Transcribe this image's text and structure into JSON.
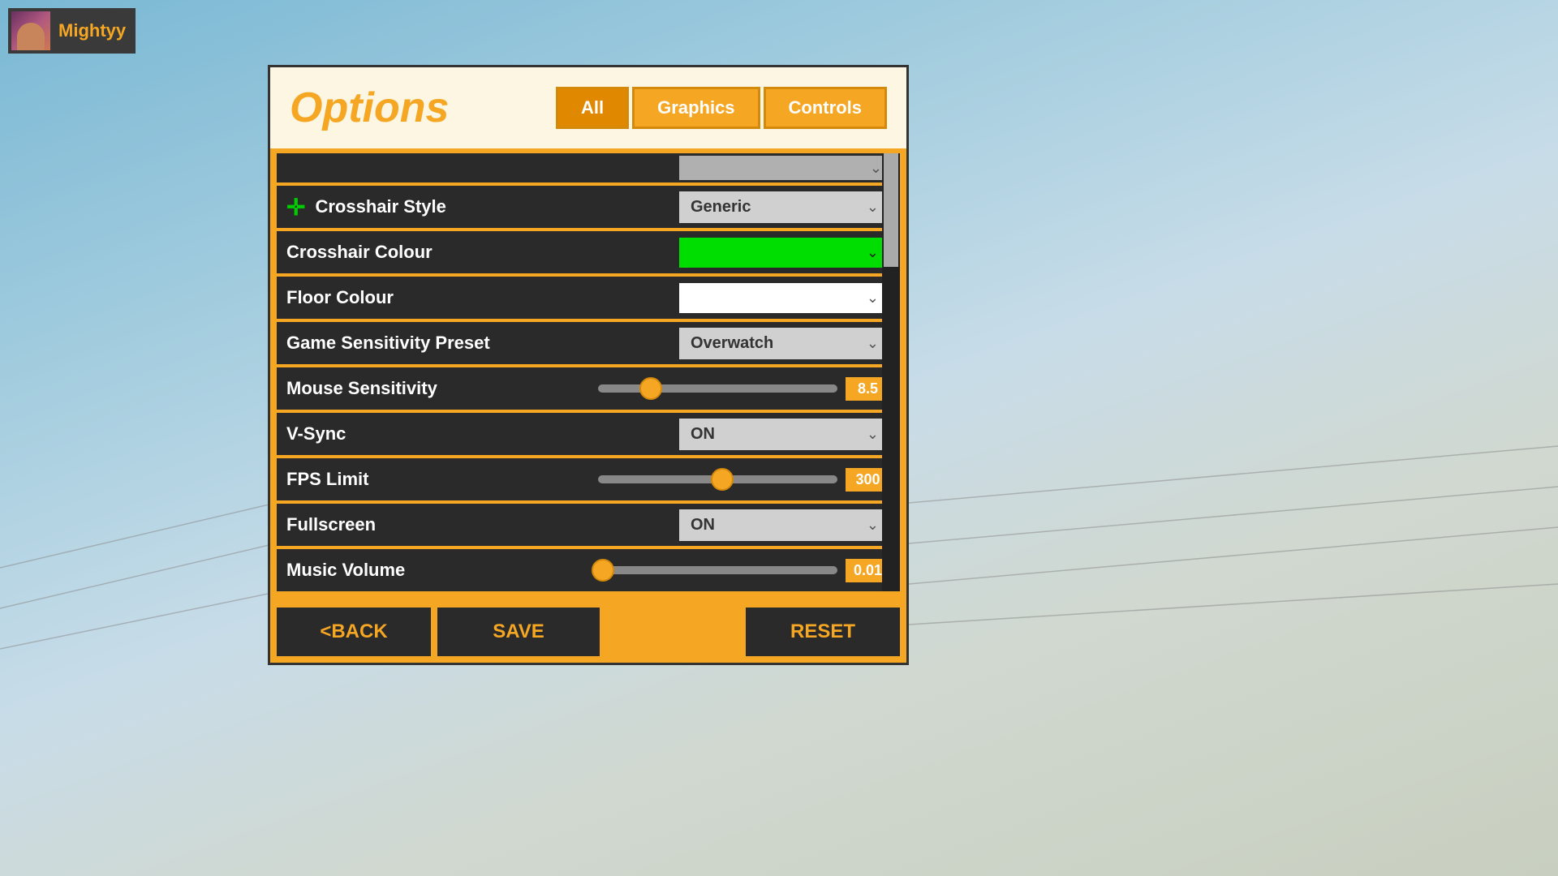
{
  "background": {
    "color_top": "#7ab8d4",
    "color_bottom": "#c8cfc0"
  },
  "user": {
    "name": "Mightyy"
  },
  "options": {
    "title": "Options",
    "tabs": [
      {
        "id": "all",
        "label": "All",
        "active": true
      },
      {
        "id": "graphics",
        "label": "Graphics",
        "active": false
      },
      {
        "id": "controls",
        "label": "Controls",
        "active": false
      }
    ]
  },
  "settings": {
    "partial_top": {
      "label": "",
      "value": ""
    },
    "crosshair_style": {
      "label": "Crosshair Style",
      "value": "Generic"
    },
    "crosshair_colour": {
      "label": "Crosshair Colour",
      "value": ""
    },
    "floor_colour": {
      "label": "Floor Colour",
      "value": ""
    },
    "game_sensitivity_preset": {
      "label": "Game Sensitivity Preset",
      "value": "Overwatch"
    },
    "mouse_sensitivity": {
      "label": "Mouse Sensitivity",
      "value": "8.5",
      "slider_percent": 22
    },
    "vsync": {
      "label": "V-Sync",
      "value": "ON"
    },
    "fps_limit": {
      "label": "FPS Limit",
      "value": "300",
      "slider_percent": 52
    },
    "fullscreen": {
      "label": "Fullscreen",
      "value": "ON"
    },
    "music_volume": {
      "label": "Music Volume",
      "value": "0.01",
      "slider_percent": 2
    }
  },
  "buttons": {
    "back": "<BACK",
    "save": "SAVE",
    "reset": "RESET"
  }
}
